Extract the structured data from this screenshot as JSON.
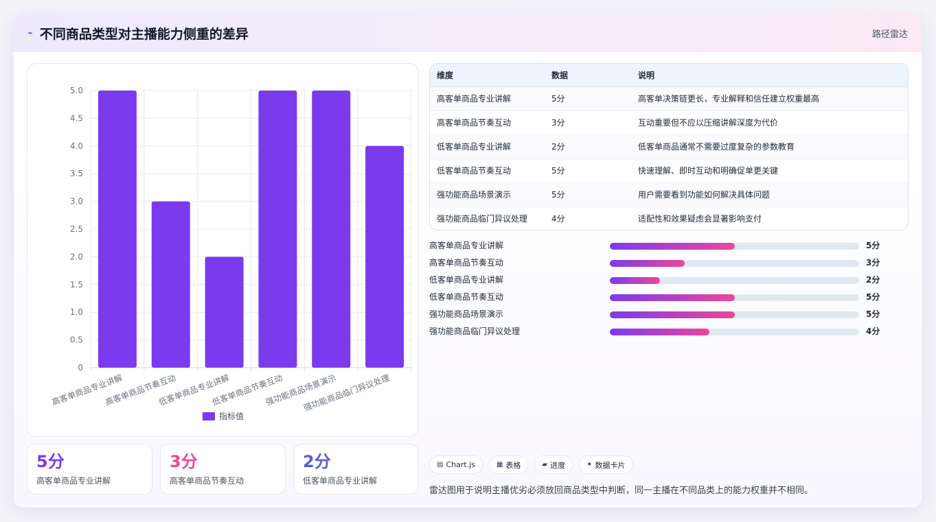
{
  "header": {
    "icon": "chart-trend-icon",
    "title": "不同商品类型对主播能力侧重的差异",
    "right_label": "路径雷达"
  },
  "chart_data": {
    "type": "bar",
    "categories": [
      "高客单商品专业讲解",
      "高客单商品节奏互动",
      "低客单商品专业讲解",
      "低客单商品节奏互动",
      "强功能商品场景演示",
      "强功能商品临门异议处理"
    ],
    "series": [
      {
        "name": "指标值",
        "values": [
          5,
          3,
          2,
          5,
          5,
          4
        ],
        "color": "#7c3aed"
      }
    ],
    "ylim": [
      0,
      5
    ],
    "yticks": [
      "0",
      "0.5",
      "1.0",
      "1.5",
      "2.0",
      "2.5",
      "3.0",
      "3.5",
      "4.0",
      "4.5",
      "5.0"
    ],
    "grid": true,
    "legend": "bottom"
  },
  "stats": [
    {
      "value": "5分",
      "label": "高客单商品专业讲解",
      "color": "#7c3aed"
    },
    {
      "value": "3分",
      "label": "高客单商品节奏互动",
      "color": "#ec4899"
    },
    {
      "value": "2分",
      "label": "低客单商品专业讲解",
      "color": "#5b5bd6"
    }
  ],
  "table": {
    "headers": [
      "维度",
      "数据",
      "说明"
    ],
    "rows": [
      [
        "高客单商品专业讲解",
        "5分",
        "高客单决策链更长，专业解释和信任建立权重最高"
      ],
      [
        "高客单商品节奏互动",
        "3分",
        "互动重要但不应以压缩讲解深度为代价"
      ],
      [
        "低客单商品专业讲解",
        "2分",
        "低客单商品通常不需要过度复杂的参数教育"
      ],
      [
        "低客单商品节奏互动",
        "5分",
        "快速理解、即时互动和明确促单更关键"
      ],
      [
        "强功能商品场景演示",
        "5分",
        "用户需要看到功能如何解决具体问题"
      ],
      [
        "强功能商品临门异议处理",
        "4分",
        "适配性和效果疑虑会显著影响支付"
      ]
    ]
  },
  "progress": [
    {
      "label": "高客单商品专业讲解",
      "value": 5,
      "display": "5分"
    },
    {
      "label": "高客单商品节奏互动",
      "value": 3,
      "display": "3分"
    },
    {
      "label": "低客单商品专业讲解",
      "value": 2,
      "display": "2分"
    },
    {
      "label": "低客单商品节奏互动",
      "value": 5,
      "display": "5分"
    },
    {
      "label": "强功能商品场景演示",
      "value": 5,
      "display": "5分"
    },
    {
      "label": "强功能商品临门异议处理",
      "value": 4,
      "display": "4分"
    }
  ],
  "progress_max": 10,
  "tags": [
    {
      "icon": "chart-icon",
      "glyph": "▤",
      "label": "Chart.js"
    },
    {
      "icon": "table-icon",
      "glyph": "▦",
      "label": "表格"
    },
    {
      "icon": "progress-icon",
      "glyph": "▰",
      "label": "进度"
    },
    {
      "icon": "sparkle-icon",
      "glyph": "✦",
      "label": "数据卡片"
    }
  ],
  "note": "雷达图用于说明主播优劣必须放回商品类型中判断，同一主播在不同品类上的能力权重并不相同。"
}
